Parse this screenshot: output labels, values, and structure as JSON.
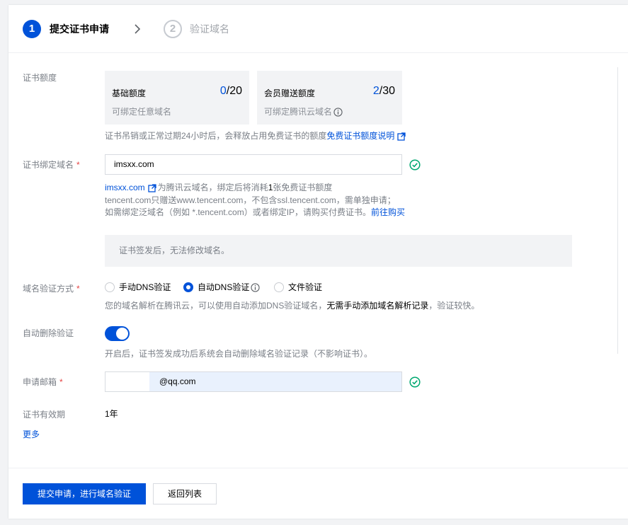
{
  "steps": [
    {
      "num": "1",
      "label": "提交证书申请"
    },
    {
      "num": "2",
      "label": "验证域名"
    }
  ],
  "quota": {
    "label": "证书额度",
    "basic": {
      "title": "基础额度",
      "used": "0",
      "total": "/20",
      "desc": "可绑定任意域名"
    },
    "member": {
      "title": "会员赠送额度",
      "used": "2",
      "total": "/30",
      "desc": "可绑定腾讯云域名"
    },
    "hint": "证书吊销或正常过期24小时后，会释放占用免费证书的额度",
    "hint_link": "免费证书额度说明"
  },
  "domain": {
    "label": "证书绑定域名",
    "required": "*",
    "value": "imsxx.com",
    "line1_link": "imsxx.com",
    "line1_a": "为腾讯云域名，绑定后将消耗",
    "line1_num": "1",
    "line1_b": "张免费证书额度",
    "line2": "tencent.com只赠送www.tencent.com，不包含ssl.tencent.com，需单独申请；",
    "line3": "如需绑定泛域名（例如 *.tencent.com）或者绑定IP，请购买付费证书。",
    "line3_link": "前往购买",
    "notice": "证书签发后，无法修改域名。"
  },
  "verify": {
    "label": "域名验证方式",
    "required": "*",
    "options": [
      "手动DNS验证",
      "自动DNS验证",
      "文件验证"
    ],
    "selected": "自动DNS验证",
    "hint_a": "您的域名解析在腾讯云，可以使用自动添加DNS验证域名，",
    "hint_b": "无需手动添加域名解析记录",
    "hint_c": "，验证较快。"
  },
  "auto_delete": {
    "label": "自动删除验证",
    "enabled": true,
    "hint": "开启后，证书签发成功后系统会自动删除域名验证记录（不影响证书）。"
  },
  "email": {
    "label": "申请邮箱",
    "required": "*",
    "value": "@qq.com"
  },
  "validity": {
    "label": "证书有效期",
    "value": "1年"
  },
  "more": "更多",
  "buttons": {
    "submit": "提交申请，进行域名验证",
    "back": "返回列表"
  },
  "colors": {
    "primary": "#0052d9",
    "success": "#00a870",
    "required": "#e54545"
  }
}
